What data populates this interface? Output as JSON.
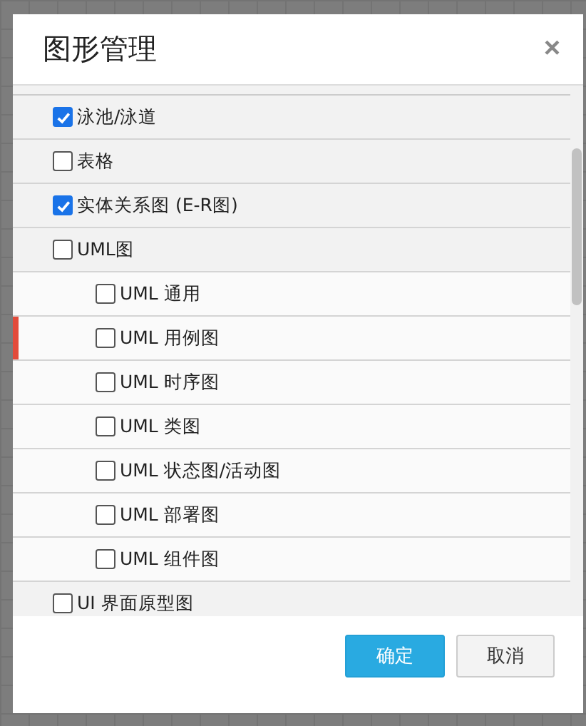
{
  "dialog": {
    "title": "图形管理",
    "close": "×"
  },
  "items": [
    {
      "label": "泳池/泳道",
      "checked": true,
      "marked": false
    },
    {
      "label": "表格",
      "checked": false,
      "marked": false
    },
    {
      "label": "实体关系图 (E-R图)",
      "checked": true,
      "marked": false
    },
    {
      "label": "UML图",
      "checked": false,
      "marked": false,
      "children": [
        {
          "label": "UML 通用",
          "checked": false,
          "marked": false
        },
        {
          "label": "UML 用例图",
          "checked": false,
          "marked": true
        },
        {
          "label": "UML 时序图",
          "checked": false,
          "marked": false
        },
        {
          "label": "UML 类图",
          "checked": false,
          "marked": false
        },
        {
          "label": "UML 状态图/活动图",
          "checked": false,
          "marked": false
        },
        {
          "label": "UML 部署图",
          "checked": false,
          "marked": false
        },
        {
          "label": "UML 组件图",
          "checked": false,
          "marked": false
        }
      ]
    },
    {
      "label": "UI 界面原型图",
      "checked": false,
      "marked": false
    }
  ],
  "buttons": [
    {
      "label": "确定",
      "kind": "primary"
    },
    {
      "label": "取消",
      "kind": "secondary"
    }
  ]
}
